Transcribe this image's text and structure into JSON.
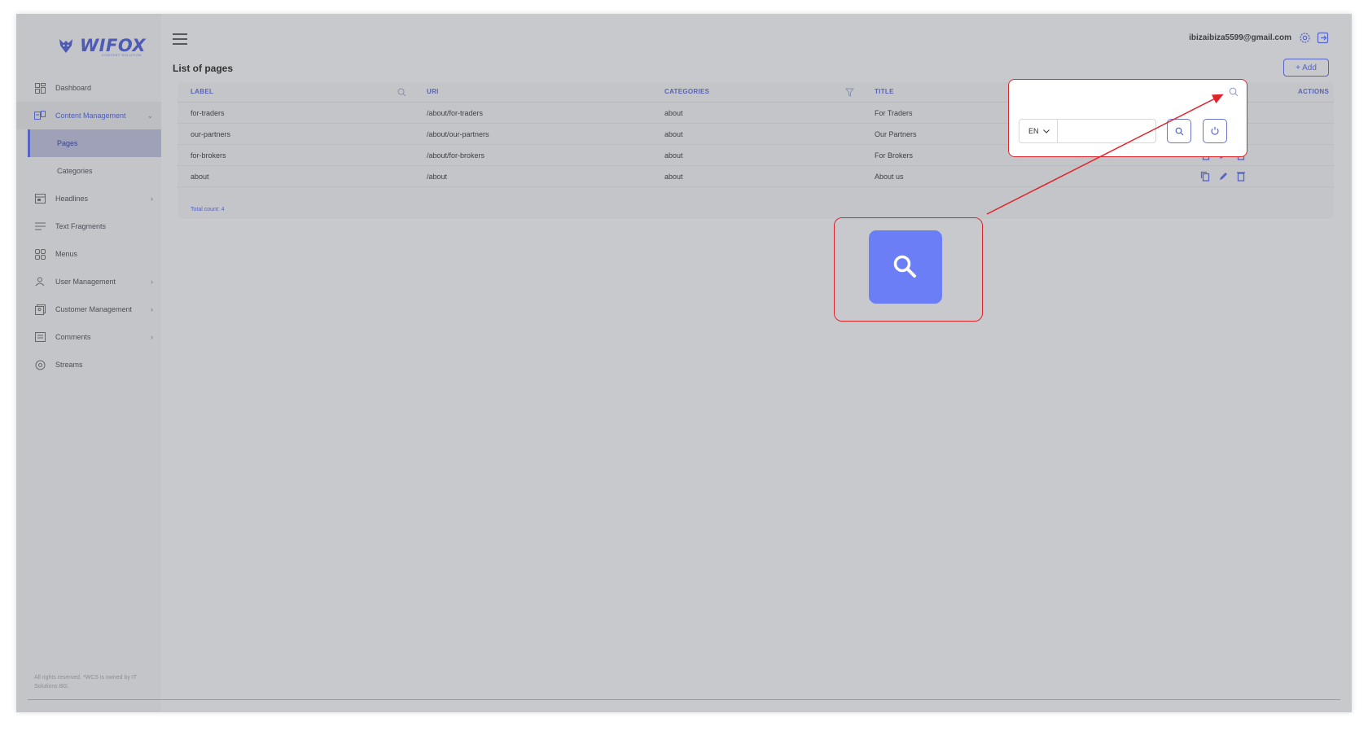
{
  "brand": {
    "name": "WIFOX",
    "tagline": "CONTENT SOLUTION"
  },
  "sidebar": {
    "items": [
      {
        "label": "Dashboard",
        "icon": "dashboard-icon"
      },
      {
        "label": "Content Management",
        "icon": "content-icon",
        "expanded": true,
        "children": [
          {
            "label": "Pages",
            "active": true
          },
          {
            "label": "Categories"
          }
        ]
      },
      {
        "label": "Headlines",
        "icon": "headlines-icon",
        "has_children": true
      },
      {
        "label": "Text Fragments",
        "icon": "text-icon"
      },
      {
        "label": "Menus",
        "icon": "menus-icon"
      },
      {
        "label": "User Management",
        "icon": "users-icon",
        "has_children": true
      },
      {
        "label": "Customer Management",
        "icon": "customer-icon",
        "has_children": true
      },
      {
        "label": "Comments",
        "icon": "comments-icon",
        "has_children": true
      },
      {
        "label": "Streams",
        "icon": "streams-icon"
      }
    ],
    "footer": "All rights reserved. *WCS is owned by IT Solutions BG."
  },
  "topbar": {
    "user_email": "ibizaibiza5599@gmail.com"
  },
  "page": {
    "title": "List of pages",
    "add_label": "+ Add"
  },
  "table": {
    "headers": {
      "label": "LABEL",
      "uri": "URI",
      "categories": "CATEGORIES",
      "title": "TITLE",
      "actions": "ACTIONS"
    },
    "rows": [
      {
        "label": "for-traders",
        "uri": "/about/for-traders",
        "categories": "about",
        "title": "For Traders"
      },
      {
        "label": "our-partners",
        "uri": "/about/our-partners",
        "categories": "about",
        "title": "Our Partners"
      },
      {
        "label": "for-brokers",
        "uri": "/about/for-brokers",
        "categories": "about",
        "title": "For Brokers"
      },
      {
        "label": "about",
        "uri": "/about",
        "categories": "about",
        "title": "About us"
      }
    ],
    "total": "Total count: 4"
  },
  "search_popup": {
    "language": "EN",
    "input_value": ""
  },
  "colors": {
    "accent": "#5563c4",
    "highlight": "#e0242b",
    "zoom_button": "#6b7ef5"
  }
}
